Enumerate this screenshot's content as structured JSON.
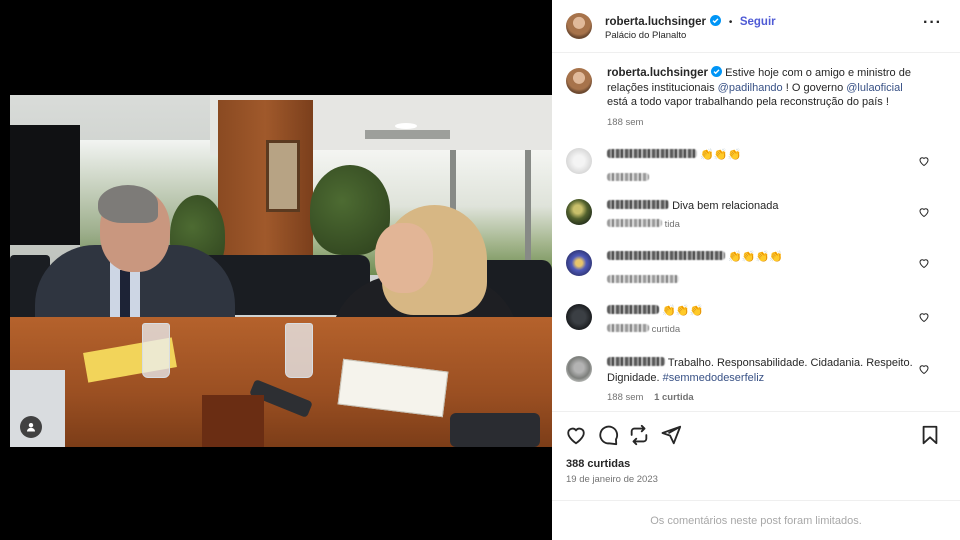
{
  "post": {
    "username": "roberta.luchsinger",
    "separator": "•",
    "follow_label": "Seguir",
    "location": "Palácio do Planalto",
    "more_icon": "more-dots-icon"
  },
  "caption": {
    "username": "roberta.luchsinger",
    "text_1": "Estive hoje com o amigo e ministro de relações institucionais ",
    "mention_1": "@padilhando",
    "text_2": " ! O governo ",
    "mention_2": "@lulaoficial",
    "text_3": " está a todo vapor trabalhando pela reconstrução do país !",
    "time": "188 sem"
  },
  "comments": [
    {
      "text": "👏👏👏",
      "meta": ""
    },
    {
      "text": "Diva bem relacionada",
      "meta": "tida"
    },
    {
      "text": "👏👏👏👏",
      "meta": ""
    },
    {
      "text": "👏👏👏",
      "meta": "curtida"
    },
    {
      "text": "Trabalho. Responsabilidade. Cidadania. Respeito. Dignidade. ",
      "hashtag": "#semmedodeserfeliz",
      "time": "188 sem",
      "likes": "1 curtida"
    }
  ],
  "actions": {
    "like_icon": "heart-icon",
    "comment_icon": "comment-icon",
    "repost_icon": "repost-icon",
    "share_icon": "share-icon",
    "save_icon": "bookmark-icon"
  },
  "likes_count": "388 curtidas",
  "date": "19 de janeiro de 2023",
  "comments_limited": "Os comentários neste post foram limitados.",
  "colors": {
    "accent": "#4f5bd5",
    "link": "#385185",
    "muted": "#737373",
    "verified": "#0095f6"
  }
}
